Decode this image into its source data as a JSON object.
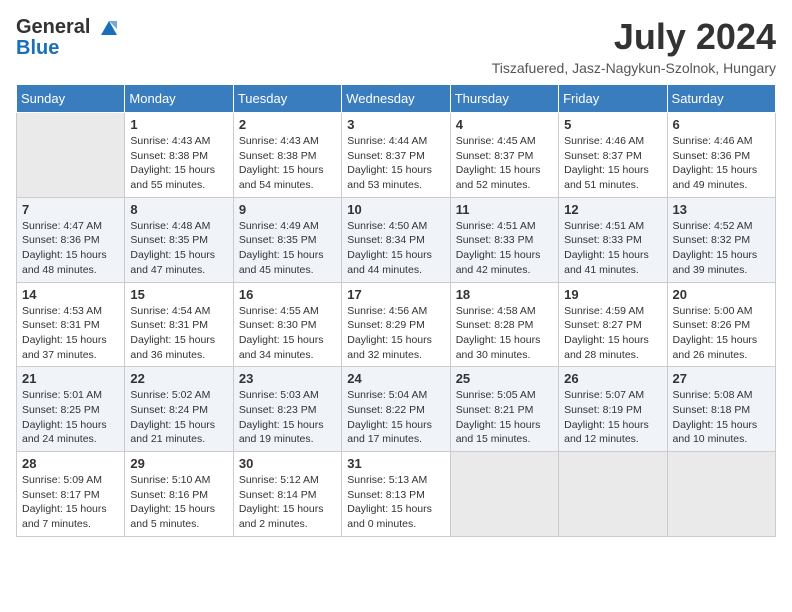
{
  "header": {
    "logo_line1": "General",
    "logo_line2": "Blue",
    "month_title": "July 2024",
    "location": "Tiszafuered, Jasz-Nagykun-Szolnok, Hungary"
  },
  "days_of_week": [
    "Sunday",
    "Monday",
    "Tuesday",
    "Wednesday",
    "Thursday",
    "Friday",
    "Saturday"
  ],
  "weeks": [
    {
      "cells": [
        {
          "day": "",
          "empty": true
        },
        {
          "day": "1",
          "sunrise": "Sunrise: 4:43 AM",
          "sunset": "Sunset: 8:38 PM",
          "daylight": "Daylight: 15 hours and 55 minutes."
        },
        {
          "day": "2",
          "sunrise": "Sunrise: 4:43 AM",
          "sunset": "Sunset: 8:38 PM",
          "daylight": "Daylight: 15 hours and 54 minutes."
        },
        {
          "day": "3",
          "sunrise": "Sunrise: 4:44 AM",
          "sunset": "Sunset: 8:37 PM",
          "daylight": "Daylight: 15 hours and 53 minutes."
        },
        {
          "day": "4",
          "sunrise": "Sunrise: 4:45 AM",
          "sunset": "Sunset: 8:37 PM",
          "daylight": "Daylight: 15 hours and 52 minutes."
        },
        {
          "day": "5",
          "sunrise": "Sunrise: 4:46 AM",
          "sunset": "Sunset: 8:37 PM",
          "daylight": "Daylight: 15 hours and 51 minutes."
        },
        {
          "day": "6",
          "sunrise": "Sunrise: 4:46 AM",
          "sunset": "Sunset: 8:36 PM",
          "daylight": "Daylight: 15 hours and 49 minutes."
        }
      ]
    },
    {
      "cells": [
        {
          "day": "7",
          "sunrise": "Sunrise: 4:47 AM",
          "sunset": "Sunset: 8:36 PM",
          "daylight": "Daylight: 15 hours and 48 minutes."
        },
        {
          "day": "8",
          "sunrise": "Sunrise: 4:48 AM",
          "sunset": "Sunset: 8:35 PM",
          "daylight": "Daylight: 15 hours and 47 minutes."
        },
        {
          "day": "9",
          "sunrise": "Sunrise: 4:49 AM",
          "sunset": "Sunset: 8:35 PM",
          "daylight": "Daylight: 15 hours and 45 minutes."
        },
        {
          "day": "10",
          "sunrise": "Sunrise: 4:50 AM",
          "sunset": "Sunset: 8:34 PM",
          "daylight": "Daylight: 15 hours and 44 minutes."
        },
        {
          "day": "11",
          "sunrise": "Sunrise: 4:51 AM",
          "sunset": "Sunset: 8:33 PM",
          "daylight": "Daylight: 15 hours and 42 minutes."
        },
        {
          "day": "12",
          "sunrise": "Sunrise: 4:51 AM",
          "sunset": "Sunset: 8:33 PM",
          "daylight": "Daylight: 15 hours and 41 minutes."
        },
        {
          "day": "13",
          "sunrise": "Sunrise: 4:52 AM",
          "sunset": "Sunset: 8:32 PM",
          "daylight": "Daylight: 15 hours and 39 minutes."
        }
      ]
    },
    {
      "cells": [
        {
          "day": "14",
          "sunrise": "Sunrise: 4:53 AM",
          "sunset": "Sunset: 8:31 PM",
          "daylight": "Daylight: 15 hours and 37 minutes."
        },
        {
          "day": "15",
          "sunrise": "Sunrise: 4:54 AM",
          "sunset": "Sunset: 8:31 PM",
          "daylight": "Daylight: 15 hours and 36 minutes."
        },
        {
          "day": "16",
          "sunrise": "Sunrise: 4:55 AM",
          "sunset": "Sunset: 8:30 PM",
          "daylight": "Daylight: 15 hours and 34 minutes."
        },
        {
          "day": "17",
          "sunrise": "Sunrise: 4:56 AM",
          "sunset": "Sunset: 8:29 PM",
          "daylight": "Daylight: 15 hours and 32 minutes."
        },
        {
          "day": "18",
          "sunrise": "Sunrise: 4:58 AM",
          "sunset": "Sunset: 8:28 PM",
          "daylight": "Daylight: 15 hours and 30 minutes."
        },
        {
          "day": "19",
          "sunrise": "Sunrise: 4:59 AM",
          "sunset": "Sunset: 8:27 PM",
          "daylight": "Daylight: 15 hours and 28 minutes."
        },
        {
          "day": "20",
          "sunrise": "Sunrise: 5:00 AM",
          "sunset": "Sunset: 8:26 PM",
          "daylight": "Daylight: 15 hours and 26 minutes."
        }
      ]
    },
    {
      "cells": [
        {
          "day": "21",
          "sunrise": "Sunrise: 5:01 AM",
          "sunset": "Sunset: 8:25 PM",
          "daylight": "Daylight: 15 hours and 24 minutes."
        },
        {
          "day": "22",
          "sunrise": "Sunrise: 5:02 AM",
          "sunset": "Sunset: 8:24 PM",
          "daylight": "Daylight: 15 hours and 21 minutes."
        },
        {
          "day": "23",
          "sunrise": "Sunrise: 5:03 AM",
          "sunset": "Sunset: 8:23 PM",
          "daylight": "Daylight: 15 hours and 19 minutes."
        },
        {
          "day": "24",
          "sunrise": "Sunrise: 5:04 AM",
          "sunset": "Sunset: 8:22 PM",
          "daylight": "Daylight: 15 hours and 17 minutes."
        },
        {
          "day": "25",
          "sunrise": "Sunrise: 5:05 AM",
          "sunset": "Sunset: 8:21 PM",
          "daylight": "Daylight: 15 hours and 15 minutes."
        },
        {
          "day": "26",
          "sunrise": "Sunrise: 5:07 AM",
          "sunset": "Sunset: 8:19 PM",
          "daylight": "Daylight: 15 hours and 12 minutes."
        },
        {
          "day": "27",
          "sunrise": "Sunrise: 5:08 AM",
          "sunset": "Sunset: 8:18 PM",
          "daylight": "Daylight: 15 hours and 10 minutes."
        }
      ]
    },
    {
      "cells": [
        {
          "day": "28",
          "sunrise": "Sunrise: 5:09 AM",
          "sunset": "Sunset: 8:17 PM",
          "daylight": "Daylight: 15 hours and 7 minutes."
        },
        {
          "day": "29",
          "sunrise": "Sunrise: 5:10 AM",
          "sunset": "Sunset: 8:16 PM",
          "daylight": "Daylight: 15 hours and 5 minutes."
        },
        {
          "day": "30",
          "sunrise": "Sunrise: 5:12 AM",
          "sunset": "Sunset: 8:14 PM",
          "daylight": "Daylight: 15 hours and 2 minutes."
        },
        {
          "day": "31",
          "sunrise": "Sunrise: 5:13 AM",
          "sunset": "Sunset: 8:13 PM",
          "daylight": "Daylight: 15 hours and 0 minutes."
        },
        {
          "day": "",
          "empty": true
        },
        {
          "day": "",
          "empty": true
        },
        {
          "day": "",
          "empty": true
        }
      ]
    }
  ],
  "colors": {
    "header_bg": "#3a7dbf",
    "header_text": "#ffffff",
    "row_odd": "#ffffff",
    "row_even": "#f0f4f8"
  }
}
